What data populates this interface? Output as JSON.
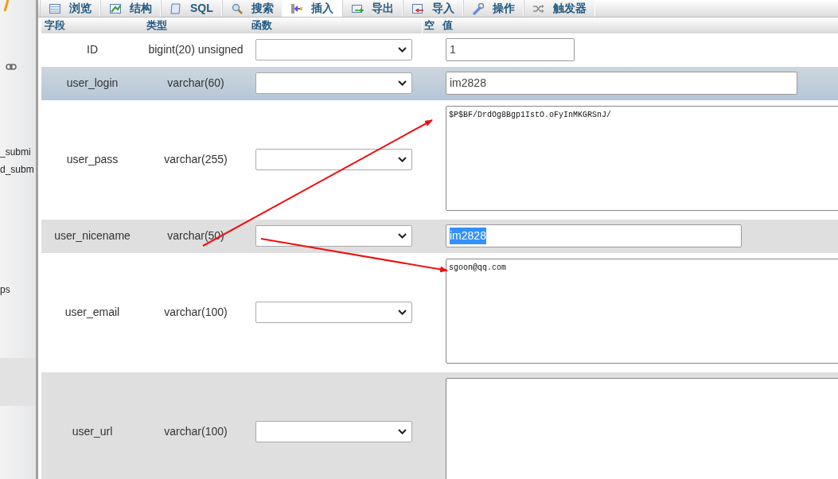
{
  "sidebar": {
    "items": [
      {
        "label": "_submi"
      },
      {
        "label": "d_subm"
      },
      {
        "label": "ps"
      }
    ]
  },
  "tabs": [
    {
      "label": "浏览",
      "selected": false
    },
    {
      "label": "结构",
      "selected": false
    },
    {
      "label": "SQL",
      "selected": false
    },
    {
      "label": "搜索",
      "selected": false
    },
    {
      "label": "插入",
      "selected": true
    },
    {
      "label": "导出",
      "selected": false
    },
    {
      "label": "导入",
      "selected": false
    },
    {
      "label": "操作",
      "selected": false
    },
    {
      "label": "触发器",
      "selected": false
    }
  ],
  "table": {
    "columns": [
      "字段",
      "类型",
      "函数",
      "空",
      "值"
    ],
    "rows": [
      {
        "field": "ID",
        "type": "bigint(20) unsigned",
        "kind": "input",
        "value": "1",
        "hovered": false,
        "text_selected": false
      },
      {
        "field": "user_login",
        "type": "varchar(60)",
        "kind": "input",
        "value": "im2828",
        "hovered": true,
        "text_selected": false
      },
      {
        "field": "user_pass",
        "type": "varchar(255)",
        "kind": "textarea",
        "value": "$P$BF/DrdOg8Bgp1IstO.oFyInMKGRSnJ/",
        "hovered": false
      },
      {
        "field": "user_nicename",
        "type": "varchar(50)",
        "kind": "input",
        "value": "im2828",
        "hovered": false,
        "text_selected": true
      },
      {
        "field": "user_email",
        "type": "varchar(100)",
        "kind": "textarea",
        "value": "sgoon@qq.com",
        "hovered": false
      },
      {
        "field": "user_url",
        "type": "varchar(100)",
        "kind": "textarea",
        "hovered": false
      }
    ]
  }
}
